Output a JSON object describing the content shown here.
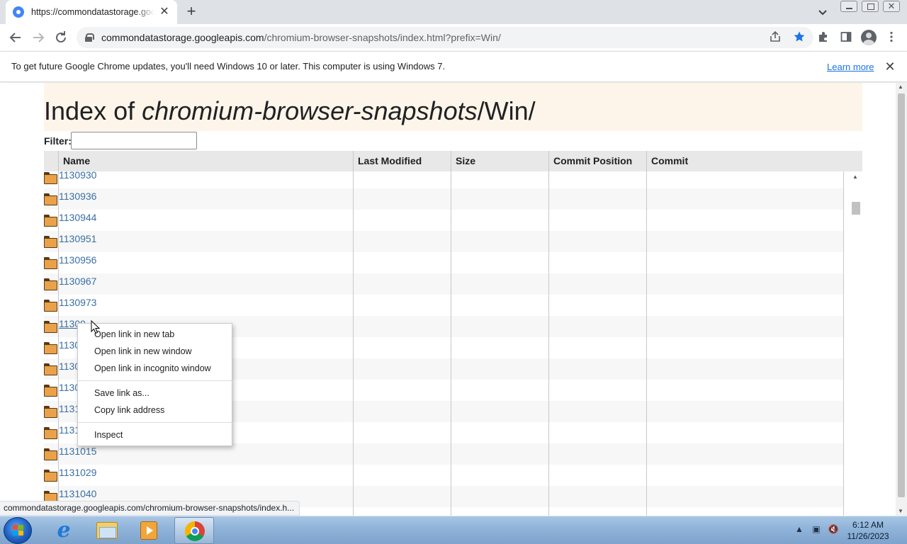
{
  "browser": {
    "tab": {
      "title": "https://commondatastorage.googleapis.com/chromium-browser-snapshots/index.html?prefix=Win/"
    },
    "new_tab_symbol": "+",
    "close_symbol": "✕",
    "omnibox": {
      "url_host": "commondatastorage.googleapis.com",
      "url_path": "/chromium-browser-snapshots/index.html?prefix=Win/"
    },
    "icons": [
      "back-icon",
      "forward-icon",
      "reload-icon",
      "lock-icon",
      "share-icon",
      "bookmark-star-icon",
      "extensions-icon",
      "side-panel-icon",
      "profile-icon",
      "menu-icon"
    ]
  },
  "infobar": {
    "message": "To get future Google Chrome updates, you'll need Windows 10 or later. This computer is using Windows 7.",
    "link": "Learn more"
  },
  "page": {
    "title_prefix": "Index of ",
    "title_italic": "chromium-browser-snapshots",
    "title_suffix": "/Win/",
    "filter_label": "Filter:",
    "filter_value": "",
    "columns": [
      "Name",
      "Last Modified",
      "Size",
      "Commit Position",
      "Commit"
    ],
    "rows": [
      "1130930",
      "1130936",
      "1130944",
      "1130951",
      "1130956",
      "1130967",
      "1130973",
      "11309",
      "1130",
      "1130",
      "1130",
      "1131",
      "1131",
      "1131015",
      "1131029",
      "1131040"
    ]
  },
  "context_menu": {
    "items": [
      "Open link in new tab",
      "Open link in new window",
      "Open link in incognito window",
      "Save link as...",
      "Copy link address",
      "Inspect"
    ]
  },
  "status_bubble": "commondatastorage.googleapis.com/chromium-browser-snapshots/index.h...",
  "taskbar": {
    "apps": [
      "internet-explorer",
      "windows-explorer",
      "media-player",
      "google-chrome"
    ],
    "tray_symbols": [
      "▲",
      "▣",
      "🔇"
    ],
    "time": "6:12 AM",
    "date": "11/26/2023"
  },
  "colors": {
    "link": "#3b6ea5",
    "header_bg": "#fdf5e9",
    "accent_blue": "#1a73e8"
  }
}
